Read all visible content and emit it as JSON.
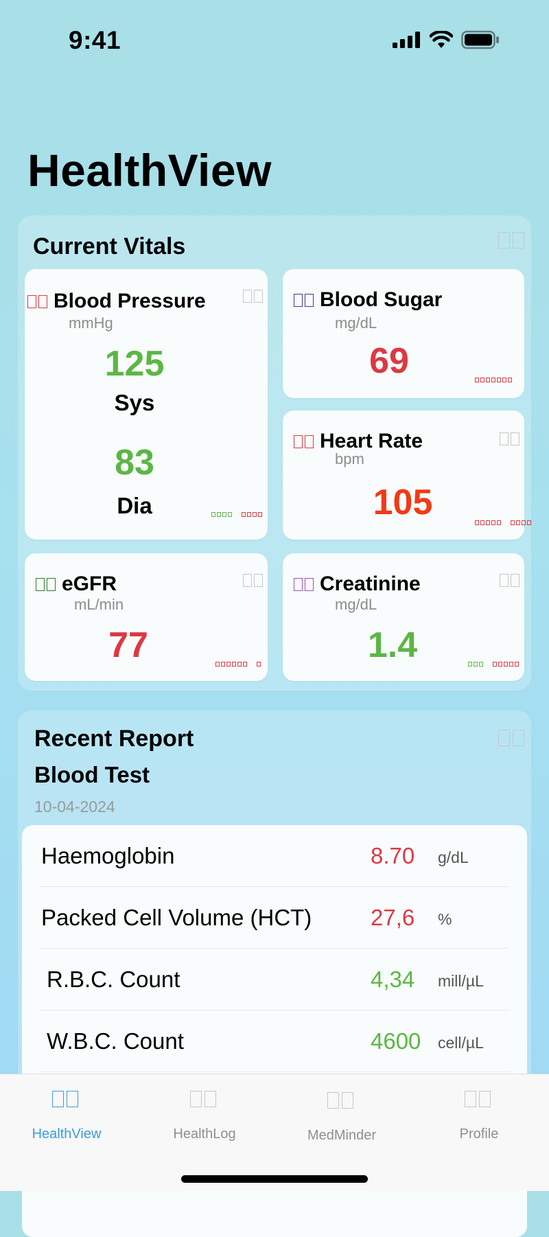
{
  "status_bar": {
    "time": "9:41",
    "icons": [
      "cellular-signal-icon",
      "wifi-icon",
      "battery-icon"
    ]
  },
  "app": {
    "title": "HealthView"
  },
  "vitals": {
    "title": "Current Vitals",
    "cards": {
      "blood_pressure": {
        "name": "Blood Pressure",
        "unit": "mmHg",
        "systolic": "125",
        "systolic_label": "Sys",
        "diastolic": "83",
        "diastolic_label": "Dia"
      },
      "blood_sugar": {
        "name": "Blood Sugar",
        "unit": "mg/dL",
        "value": "69"
      },
      "heart_rate": {
        "name": "Heart Rate",
        "unit": "bpm",
        "value": "105"
      },
      "egfr": {
        "name": "eGFR",
        "unit": "mL/min",
        "value": "77"
      },
      "creatinine": {
        "name": "Creatinine",
        "unit": "mg/dL",
        "value": "1.4"
      }
    }
  },
  "report": {
    "title": "Recent Report",
    "subtitle": "Blood Test",
    "date": "10-04-2024",
    "rows": [
      {
        "name": "Haemoglobin",
        "value": "8.70",
        "unit": "g/dL",
        "status": "abnormal"
      },
      {
        "name": "Packed Cell Volume (HCT)",
        "value": "27,6",
        "unit": "%",
        "status": "abnormal"
      },
      {
        "name": "R.B.C. Count",
        "value": "4,34",
        "unit": "mill/µL",
        "status": "normal"
      },
      {
        "name": "W.B.C. Count",
        "value": "4600",
        "unit": "cell/µL",
        "status": "normal"
      }
    ]
  },
  "tabs": [
    {
      "label": "HealthView",
      "active": true
    },
    {
      "label": "HealthLog",
      "active": false
    },
    {
      "label": "MedMinder",
      "active": false
    },
    {
      "label": "Profile",
      "active": false
    }
  ],
  "colors": {
    "normal": "#5cb645",
    "abnormal": "#dc3943",
    "high_alert": "#f03a16",
    "active_tab": "#3a9be0"
  }
}
